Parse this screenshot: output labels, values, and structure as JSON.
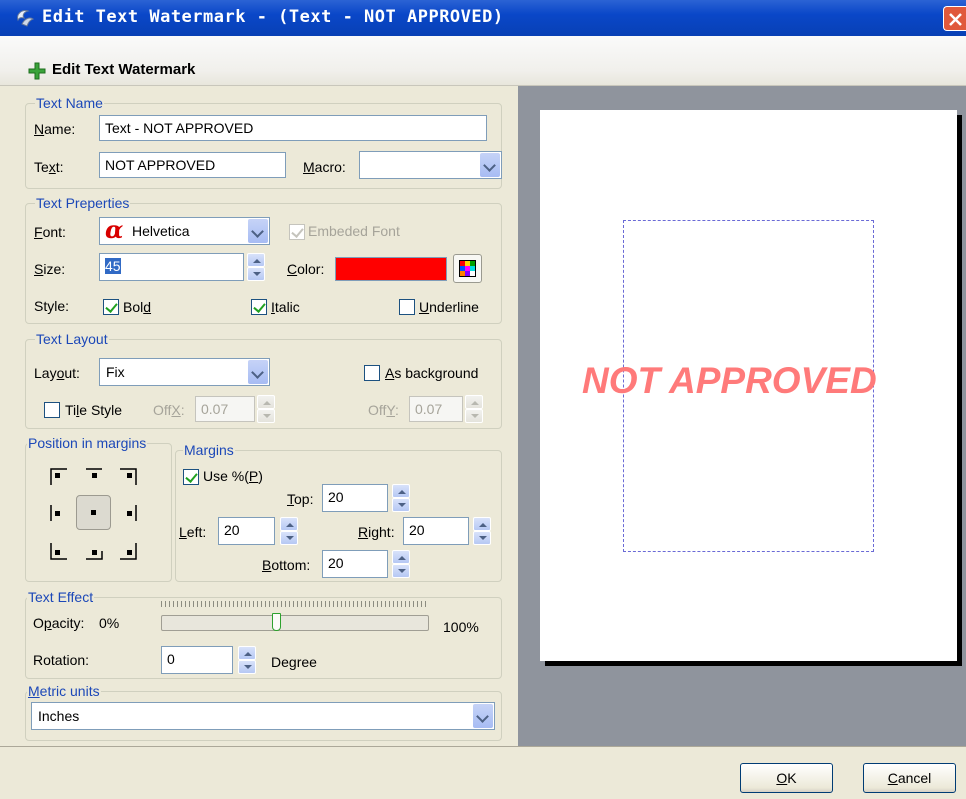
{
  "window": {
    "title": "Edit Text Watermark - (Text - NOT APPROVED)",
    "header": "Edit Text Watermark"
  },
  "text_name": {
    "legend": "Text Name",
    "name_label": "Name:",
    "name_value": "Text - NOT APPROVED",
    "text_label": "Text:",
    "text_value": "NOT APPROVED",
    "macro_label": "Macro:",
    "macro_value": ""
  },
  "text_properties": {
    "legend": "Text Preperties",
    "font_label": "Font:",
    "font_value": "Helvetica",
    "embedded_font_label": "Embeded Font",
    "embedded_font_checked": true,
    "size_label": "Size:",
    "size_value": "45",
    "color_label": "Color:",
    "color_value": "#ff0000",
    "style_label": "Style:",
    "bold_label": "Bold",
    "bold_checked": true,
    "italic_label": "Italic",
    "italic_checked": true,
    "underline_label": "Underline",
    "underline_checked": false
  },
  "text_layout": {
    "legend": "Text Layout",
    "layout_label": "Layout:",
    "layout_value": "Fix",
    "as_background_label": "As background",
    "as_background_checked": false,
    "tile_style_label": "Tile Style",
    "tile_style_checked": false,
    "offx_label": "OffX:",
    "offx_value": "0.07",
    "offy_label": "OffY:",
    "offy_value": "0.07"
  },
  "position": {
    "legend": "Position in margins",
    "selected": "center"
  },
  "margins": {
    "legend": "Margins",
    "use_percent_label": "Use %(P)",
    "use_percent_checked": true,
    "top_label": "Top:",
    "top_value": "20",
    "left_label": "Left:",
    "left_value": "20",
    "right_label": "Right:",
    "right_value": "20",
    "bottom_label": "Bottom:",
    "bottom_value": "20"
  },
  "text_effect": {
    "legend": "Text Effect",
    "opacity_label": "Opacity:",
    "opacity_min": "0%",
    "opacity_max": "100%",
    "opacity_level": 0.43,
    "rotation_label": "Rotation:",
    "rotation_value": "0",
    "degree_label": "Degree"
  },
  "metric_units": {
    "legend": "Metric units",
    "value": "Inches"
  },
  "preview": {
    "watermark_text": "NOT APPROVED",
    "watermark_color": "#ff7a7a"
  },
  "buttons": {
    "ok": "OK",
    "cancel": "Cancel"
  },
  "colors": {
    "title_bar": "#0a47c8",
    "legend_text": "#1c48b8",
    "preview_bg": "#8f949d"
  }
}
